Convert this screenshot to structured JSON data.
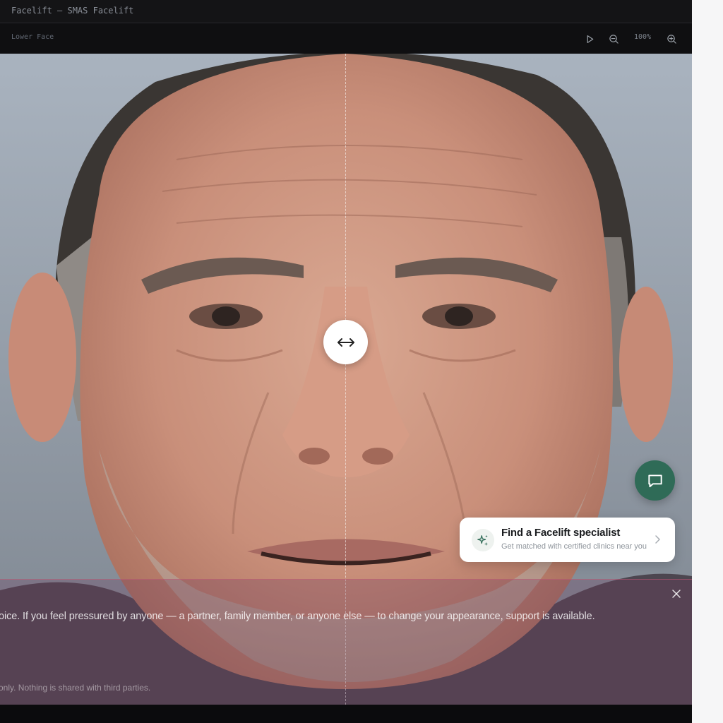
{
  "window": {
    "title": "Facelift — SMAS Facelift"
  },
  "toolbar": {
    "section_label": "Lower Face",
    "zoom_level": "100%",
    "play_icon": "play-icon",
    "zoom_out_icon": "zoom-out-icon",
    "zoom_in_icon": "zoom-in-icon"
  },
  "viewer": {
    "image": "before-after-face-photo",
    "compare_handle_icon": "left-right-arrow-icon"
  },
  "chat": {
    "icon": "chat-bubble-icon",
    "color": "#2f6b57"
  },
  "specialist_card": {
    "title": "Find a Facelift specialist",
    "subtitle": "Get matched with certified clinics near you",
    "icon": "sparkle-icon",
    "chevron_icon": "chevron-right-icon"
  },
  "notice": {
    "text": "oice. If you feel pressured by anyone — a partner, family member, or anyone else — to change your appearance, support is available.",
    "footnote": "only. Nothing is shared with third parties.",
    "close_icon": "close-icon",
    "accent_color": "#c85a78"
  }
}
